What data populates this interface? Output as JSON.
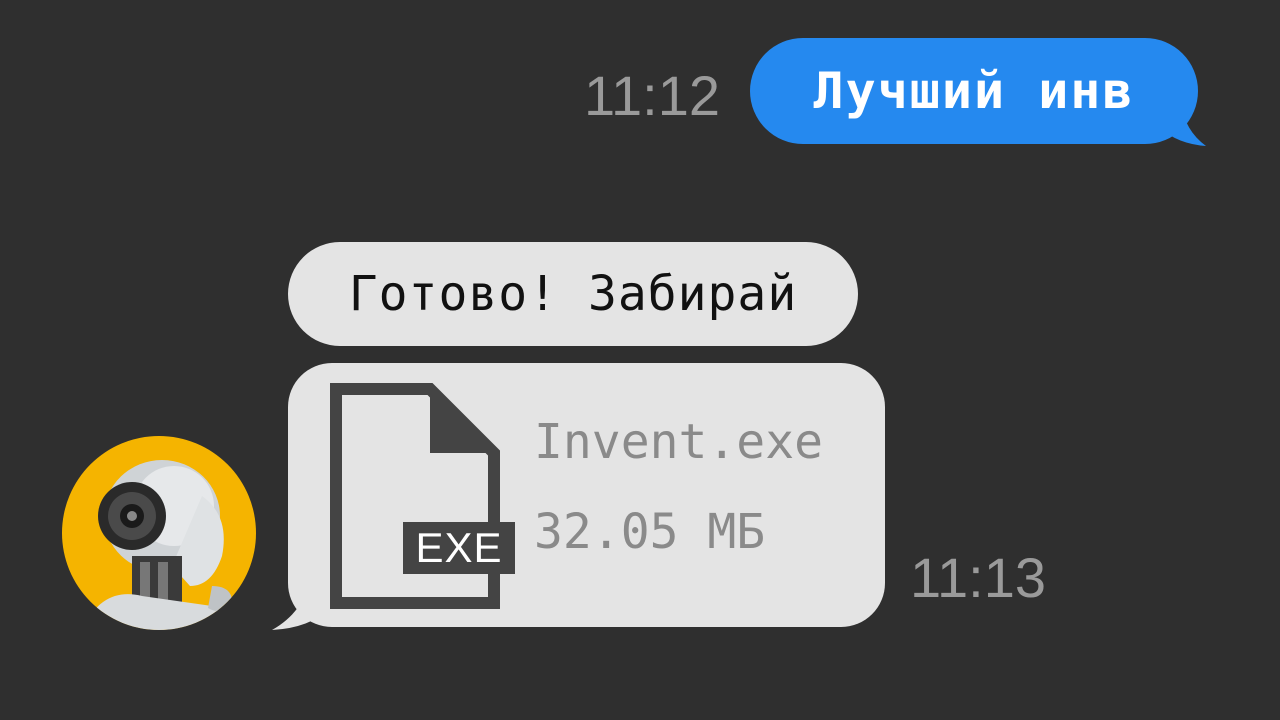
{
  "colors": {
    "background": "#2f2f2f",
    "outgoing_bubble": "#2589ef",
    "incoming_bubble": "#e4e4e4",
    "timestamp": "#9a9a9a",
    "avatar_bg": "#f5b400"
  },
  "messages": {
    "outgoing": {
      "time": "11:12",
      "text": "Лучший инв"
    },
    "incoming_text": {
      "text": "Готово! Забирай"
    },
    "incoming_file": {
      "icon": "file-exe-icon",
      "extension": "EXE",
      "file_name": "Invent.exe",
      "file_size": "32.05 МБ",
      "time": "11:13"
    }
  },
  "avatar": {
    "icon": "robot-avatar"
  }
}
